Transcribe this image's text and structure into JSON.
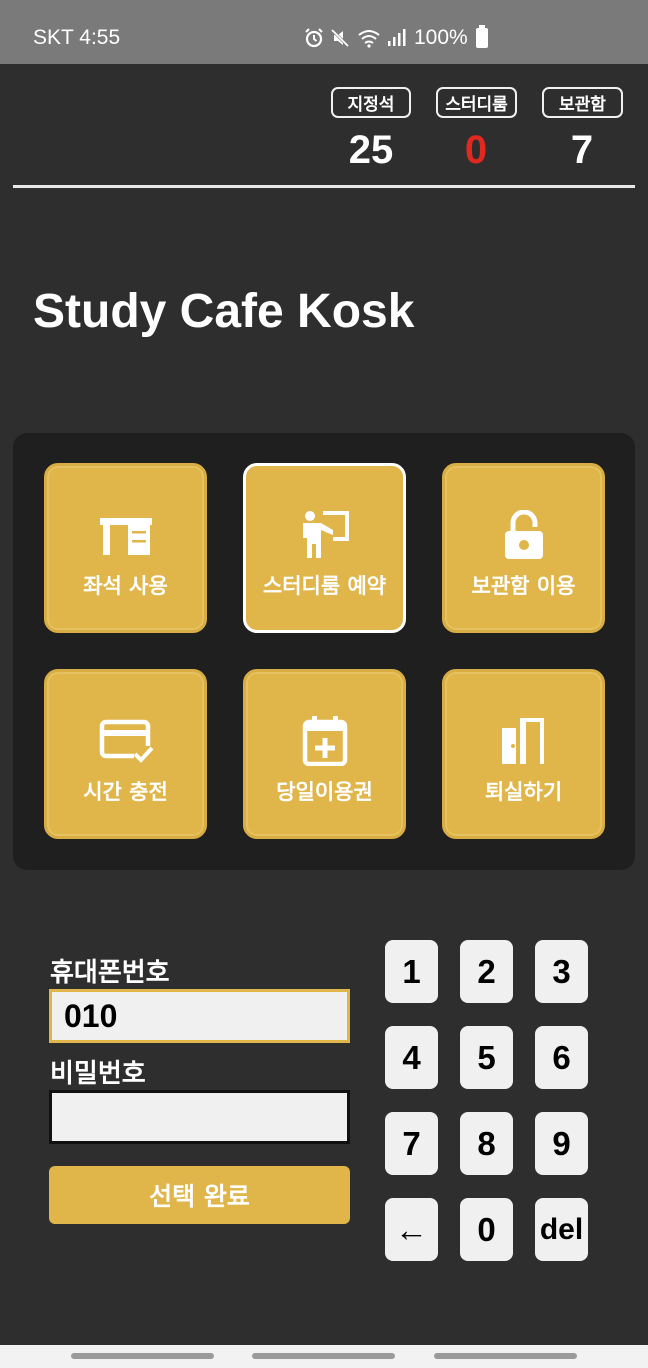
{
  "status_bar": {
    "carrier_time": "SKT 4:55",
    "battery": "100%",
    "icons": [
      "alarm-icon",
      "mute-icon",
      "wifi-icon",
      "signal-icon",
      "battery-icon"
    ]
  },
  "counters": [
    {
      "label": "지정석",
      "value": "25",
      "color": "#ffffff"
    },
    {
      "label": "스터디룸",
      "value": "0",
      "color": "#e0291f"
    },
    {
      "label": "보관함",
      "value": "7",
      "color": "#ffffff"
    }
  ],
  "app_title": "Study Cafe Kosk",
  "menu": [
    {
      "label": "좌석 사용",
      "icon": "desk-icon",
      "selected": false
    },
    {
      "label": "스터디룸 예약",
      "icon": "presenter-icon",
      "selected": true
    },
    {
      "label": "보관함 이용",
      "icon": "lock-open-icon",
      "selected": false
    },
    {
      "label": "시간 충전",
      "icon": "card-check-icon",
      "selected": false
    },
    {
      "label": "당일이용권",
      "icon": "calendar-plus-icon",
      "selected": false
    },
    {
      "label": "퇴실하기",
      "icon": "door-exit-icon",
      "selected": false
    }
  ],
  "form": {
    "phone_label": "휴대폰번호",
    "phone_value": "010",
    "password_label": "비밀번호",
    "password_value": "",
    "submit_label": "선택 완료"
  },
  "keypad": [
    "1",
    "2",
    "3",
    "4",
    "5",
    "6",
    "7",
    "8",
    "9",
    "←",
    "0",
    "del"
  ],
  "colors": {
    "accent": "#e0b54a",
    "background": "#2e2e2e",
    "panel": "#1f1f1f",
    "alert": "#e0291f"
  }
}
